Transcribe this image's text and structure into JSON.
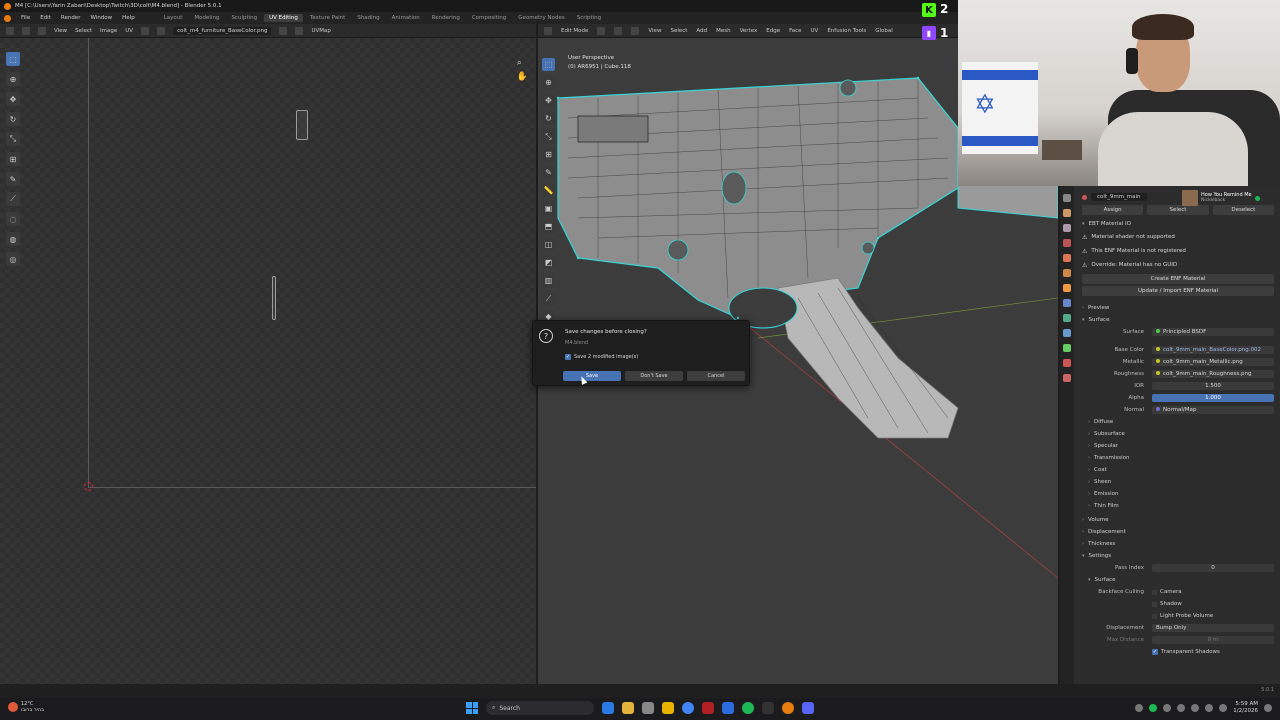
{
  "window": {
    "title": "M4 [C:\\Users\\Yarin Zabari\\Desktop\\Twitch\\3D\\colt\\M4.blend] - Blender 5.0.1"
  },
  "menubar": {
    "items": [
      "File",
      "Edit",
      "Render",
      "Window",
      "Help"
    ],
    "workspaces": [
      "Layout",
      "Modeling",
      "Sculpting",
      "UV Editing",
      "Texture Paint",
      "Shading",
      "Animation",
      "Rendering",
      "Compositing",
      "Geometry Nodes",
      "Scripting"
    ],
    "active_workspace": "UV Editing"
  },
  "uv_header": {
    "menus": [
      "View",
      "Select",
      "Image",
      "UV"
    ],
    "image_name": "colt_m4_furniture_BaseColor.png",
    "uvmap": "UVMap"
  },
  "viewport_header": {
    "mode": "Edit Mode",
    "menus": [
      "View",
      "Select",
      "Add",
      "Mesh",
      "Vertex",
      "Edge",
      "Face",
      "UV",
      "Enfusion Tools"
    ],
    "orientation": "Global"
  },
  "viewport": {
    "perspective": "User Perspective",
    "object_info": "(0) AR6951 | Cube.118"
  },
  "stream_overlay": {
    "kick_viewers": "2",
    "twitch_viewers": "1",
    "now_playing_title": "How You Remind Me",
    "now_playing_artist": "Nickelback"
  },
  "properties": {
    "material_name": "colt_9mm_main",
    "assign": "Assign",
    "select": "Select",
    "deselect": "Deselect",
    "ebt_panel": "EBT Material IO",
    "warnings": [
      "Material shader not supported",
      "This ENF Material is not registered",
      "Override: Material has no GUID"
    ],
    "create_enf": "Create ENF Material",
    "update_enf": "Update / Import ENF Material",
    "preview": "Preview",
    "surface_section": "Surface",
    "surface_label": "Surface",
    "surface_value": "Principled BSDF",
    "base_color_label": "Base Color",
    "base_color_value": "colt_9mm_main_BaseColor.png.002",
    "metallic_label": "Metallic",
    "metallic_value": "colt_9mm_main_Metallic.png",
    "roughness_label": "Roughness",
    "roughness_value": "colt_9mm_main_Roughness.png",
    "ior_label": "IOR",
    "ior_value": "1.500",
    "alpha_label": "Alpha",
    "alpha_value": "1.000",
    "normal_label": "Normal",
    "normal_value": "Normal/Map",
    "subsections": [
      "Diffuse",
      "Subsurface",
      "Specular",
      "Transmission",
      "Coat",
      "Sheen",
      "Emission",
      "Thin Film"
    ],
    "volume": "Volume",
    "displacement_section": "Displacement",
    "thickness": "Thickness",
    "settings": "Settings",
    "pass_index_label": "Pass Index",
    "pass_index_value": "0",
    "surface_sub": "Surface",
    "backface_culling_label": "Backface Culling",
    "camera": "Camera",
    "shadow": "Shadow",
    "light_probe_volume": "Light Probe Volume",
    "displacement_label": "Displacement",
    "displacement_value": "Bump Only",
    "max_distance_label": "Max Distance",
    "max_distance_value": "0 m",
    "transparent_shadows": "Transparent Shadows"
  },
  "dialog": {
    "title": "Save changes before closing?",
    "file": "M4.blend",
    "checkbox_label": "Save 2 modified image(s)",
    "save": "Save",
    "dont_save": "Don't Save",
    "cancel": "Cancel"
  },
  "statusbar": {
    "version": "5.0.1"
  },
  "taskbar": {
    "temperature": "12°C",
    "weather": "בהיר ברובו",
    "search": "Search",
    "time": "5:59 AM",
    "date": "1/2/2026"
  },
  "colors": {
    "accent": "#4772b3",
    "selection_cyan": "#36d6d6",
    "kick_green": "#53fc18",
    "twitch_purple": "#9146ff"
  }
}
